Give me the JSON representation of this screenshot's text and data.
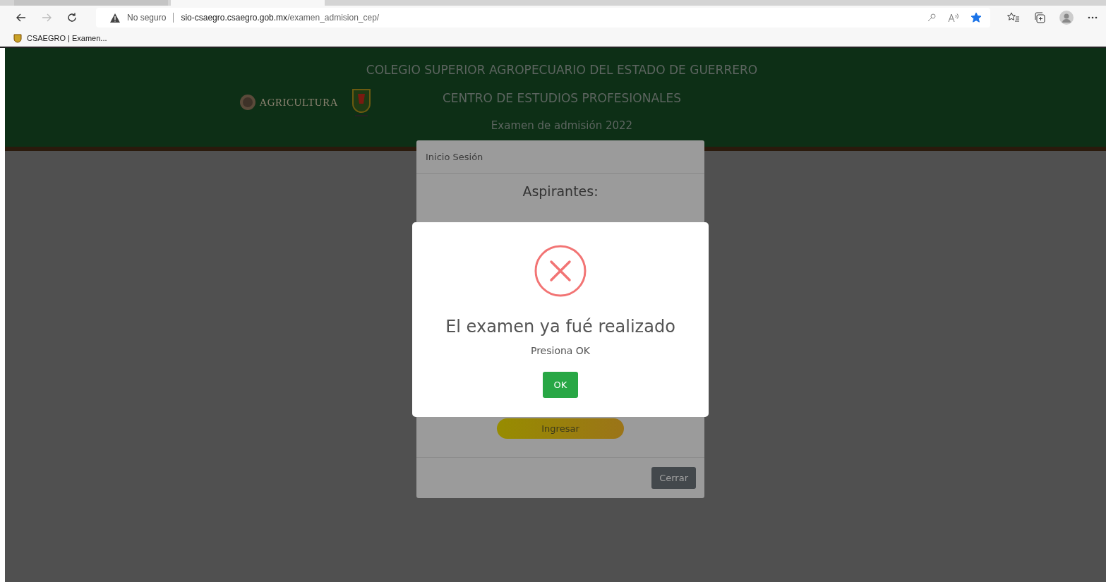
{
  "browser": {
    "security": "No seguro",
    "url_host": "sio-csaegro.csaegro.gob.mx",
    "url_path": "/examen_admision_cep/",
    "favorite": true,
    "bookmarks": [
      "CSAEGRO | Examen..."
    ]
  },
  "header": {
    "lines": [
      "COLEGIO SUPERIOR AGROPECUARIO DEL ESTADO DE GUERRERO",
      "CENTRO DE ESTUDIOS PROFESIONALES",
      "Examen de admisión 2022"
    ],
    "logo_text": "AGRICULTURA"
  },
  "login_modal": {
    "title": "Inicio Sesión",
    "heading": "Aspirantes:",
    "submit": "Ingresar",
    "close": "Cerrar"
  },
  "alert": {
    "title": "El examen ya fué realizado",
    "message": "Presiona OK",
    "button": "OK"
  }
}
